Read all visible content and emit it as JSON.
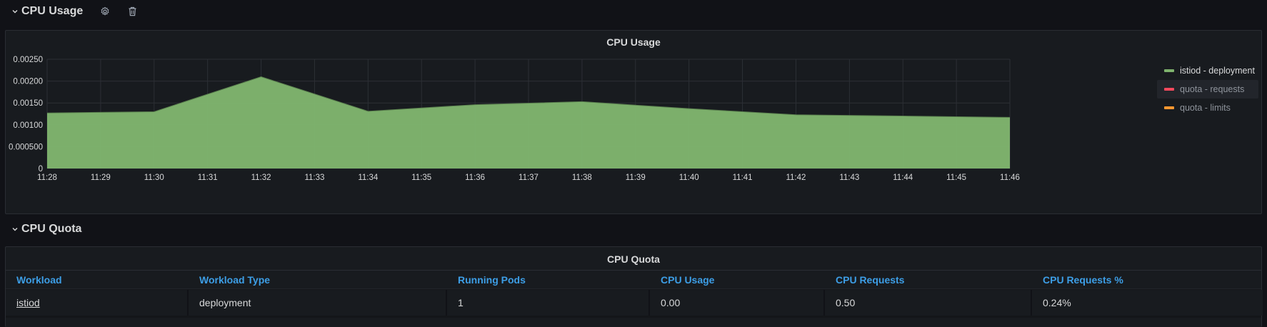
{
  "rows": {
    "cpu_usage": {
      "title": "CPU Usage"
    },
    "cpu_quota": {
      "title": "CPU Quota"
    }
  },
  "chart_panel": {
    "title": "CPU Usage"
  },
  "chart_data": {
    "type": "area",
    "title": "CPU Usage",
    "x": [
      "11:28",
      "11:29",
      "11:30",
      "11:31",
      "11:32",
      "11:33",
      "11:34",
      "11:35",
      "11:36",
      "11:37",
      "11:38",
      "11:39",
      "11:40",
      "11:41",
      "11:42",
      "11:43",
      "11:44",
      "11:45",
      "11:46"
    ],
    "y_ticks": [
      "0",
      "0.000500",
      "0.00100",
      "0.00150",
      "0.00200",
      "0.00250"
    ],
    "ylim": [
      0,
      0.0025
    ],
    "grid": true,
    "legend_position": "right",
    "series": [
      {
        "name": "istiod - deployment",
        "color": "#7eb26d",
        "points": [
          [
            0,
            0.00127
          ],
          [
            2,
            0.0013
          ],
          [
            4,
            0.0021
          ],
          [
            6,
            0.00131
          ],
          [
            8,
            0.00146
          ],
          [
            10,
            0.00153
          ],
          [
            12,
            0.00137
          ],
          [
            14,
            0.00123
          ],
          [
            16,
            0.0012
          ],
          [
            18,
            0.00117
          ]
        ]
      },
      {
        "name": "quota - requests",
        "color": "#f2495c",
        "points": []
      },
      {
        "name": "quota - limits",
        "color": "#ff9830",
        "points": []
      }
    ]
  },
  "legend": [
    {
      "name": "istiod - deployment",
      "color": "#7eb26d"
    },
    {
      "name": "quota - requests",
      "color": "#f2495c"
    },
    {
      "name": "quota - limits",
      "color": "#ff9830"
    }
  ],
  "table_panel": {
    "title": "CPU Quota",
    "columns": [
      "Workload",
      "Workload Type",
      "Running Pods",
      "CPU Usage",
      "CPU Requests",
      "CPU Requests %"
    ],
    "rows": [
      [
        "istiod",
        "deployment",
        "1",
        "0.00",
        "0.50",
        "0.24%"
      ]
    ]
  },
  "icons": {
    "collapse": "chevron-down-icon",
    "settings": "gear-icon",
    "delete": "trash-icon"
  }
}
